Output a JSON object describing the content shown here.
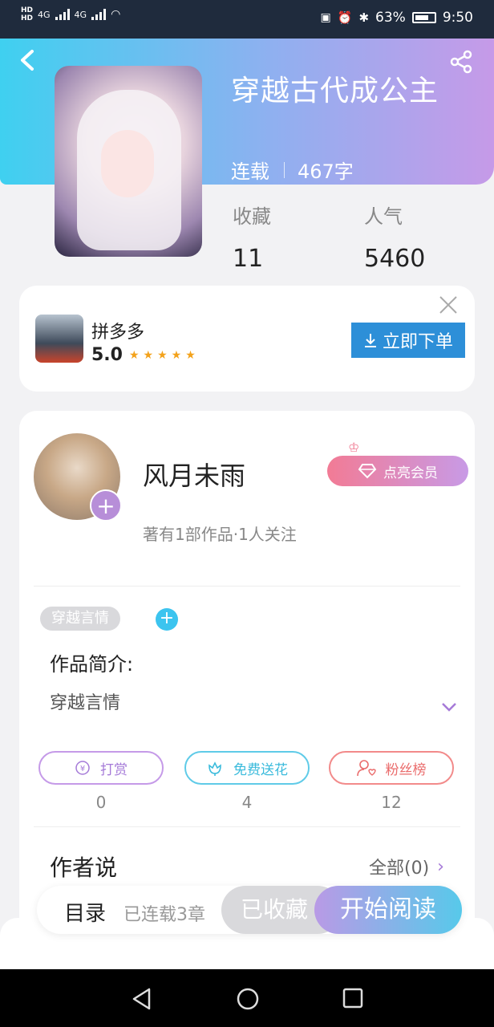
{
  "status_bar": {
    "net1": "4G",
    "net2": "4G",
    "battery": "63%",
    "time": "9:50"
  },
  "book": {
    "title": "穿越古代成公主",
    "status": "连载",
    "word_count": "467字",
    "stats": [
      {
        "label": "收藏",
        "value": "11"
      },
      {
        "label": "人气",
        "value": "5460"
      }
    ]
  },
  "ad": {
    "name": "拼多多",
    "rating": "5.0",
    "stars": "★★★★★",
    "button": "立即下单"
  },
  "author": {
    "name": "风月未雨",
    "summary": "著有1部作品·1人关注",
    "vip_button": "点亮会员"
  },
  "tag": "穿越言情",
  "intro": {
    "title": "作品简介:",
    "text": "穿越言情"
  },
  "actions": [
    {
      "label": "打赏",
      "count": "0"
    },
    {
      "label": "免费送花",
      "count": "4"
    },
    {
      "label": "粉丝榜",
      "count": "12"
    }
  ],
  "author_says": {
    "title": "作者说",
    "all_link": "全部(0)"
  },
  "bottom_bar": {
    "toc": "目录",
    "chapters": "已连载3章",
    "favorited": "已收藏",
    "start_reading": "开始阅读"
  },
  "colors": {
    "header_gradient_start": "#3fd0f0",
    "header_gradient_end": "#c69ae8",
    "ad_button": "#2d8fd8",
    "accent_purple": "#a67ad8"
  }
}
